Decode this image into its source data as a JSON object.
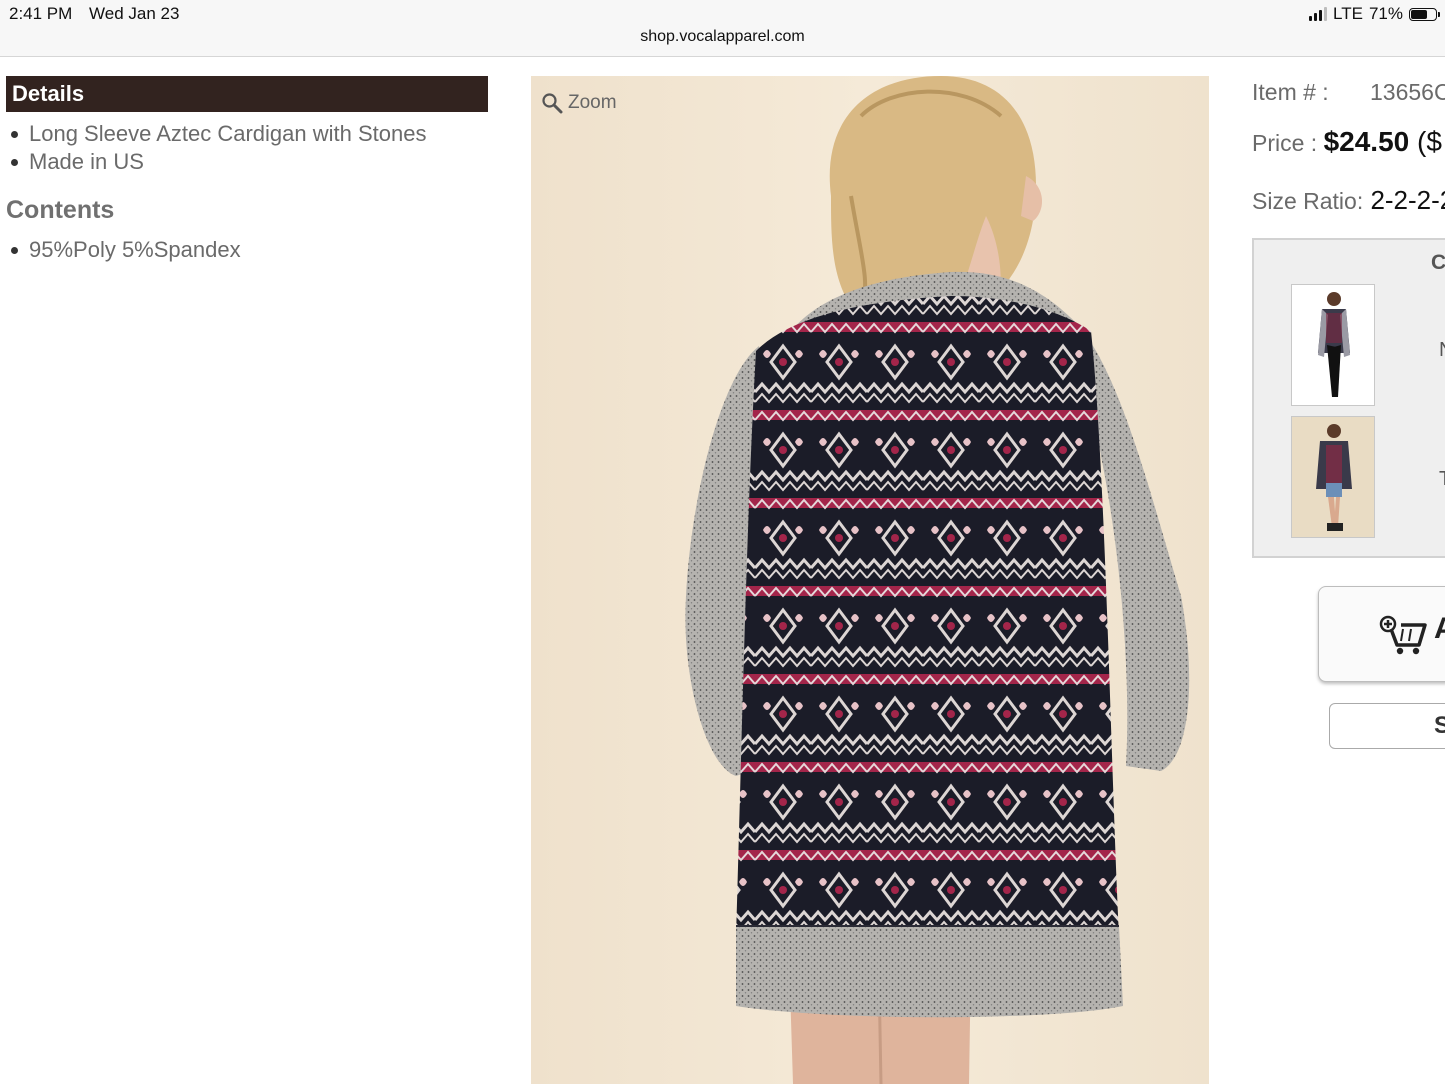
{
  "status_bar": {
    "time": "2:41 PM",
    "date": "Wed Jan 23",
    "network": "LTE",
    "battery_percent": "71%",
    "battery_level": 0.71,
    "signal_bars": 3,
    "url": "shop.vocalapparel.com"
  },
  "details": {
    "heading": "Details",
    "items": [
      "Long Sleeve Aztec Cardigan with Stones",
      "Made in US"
    ]
  },
  "contents": {
    "heading": "Contents",
    "items": [
      "95%Poly 5%Spandex"
    ]
  },
  "photo": {
    "zoom_label": "Zoom",
    "zoom_icon": "magnifier-icon"
  },
  "product_info": {
    "item_label": "Item # :",
    "item_value": "13656C",
    "price_label": "Price : ",
    "price_value": "$24.50",
    "price_extra": " ($",
    "size_label": "Size Ratio:",
    "size_value": " 2-2-2-2"
  },
  "color_panel": {
    "title": "C",
    "row1_text": "N",
    "row2_text": "T"
  },
  "buttons": {
    "add_to_cart_label": "A",
    "add_to_cart_icon": "cart-plus-icon",
    "secondary_label": "S"
  },
  "colors": {
    "details_header_bg": "#32231f",
    "photo_bg": "#f1e5d2",
    "sweater_navy": "#1b1c28",
    "sweater_red": "#a3254a",
    "sweater_gray": "#b4b2ae"
  }
}
